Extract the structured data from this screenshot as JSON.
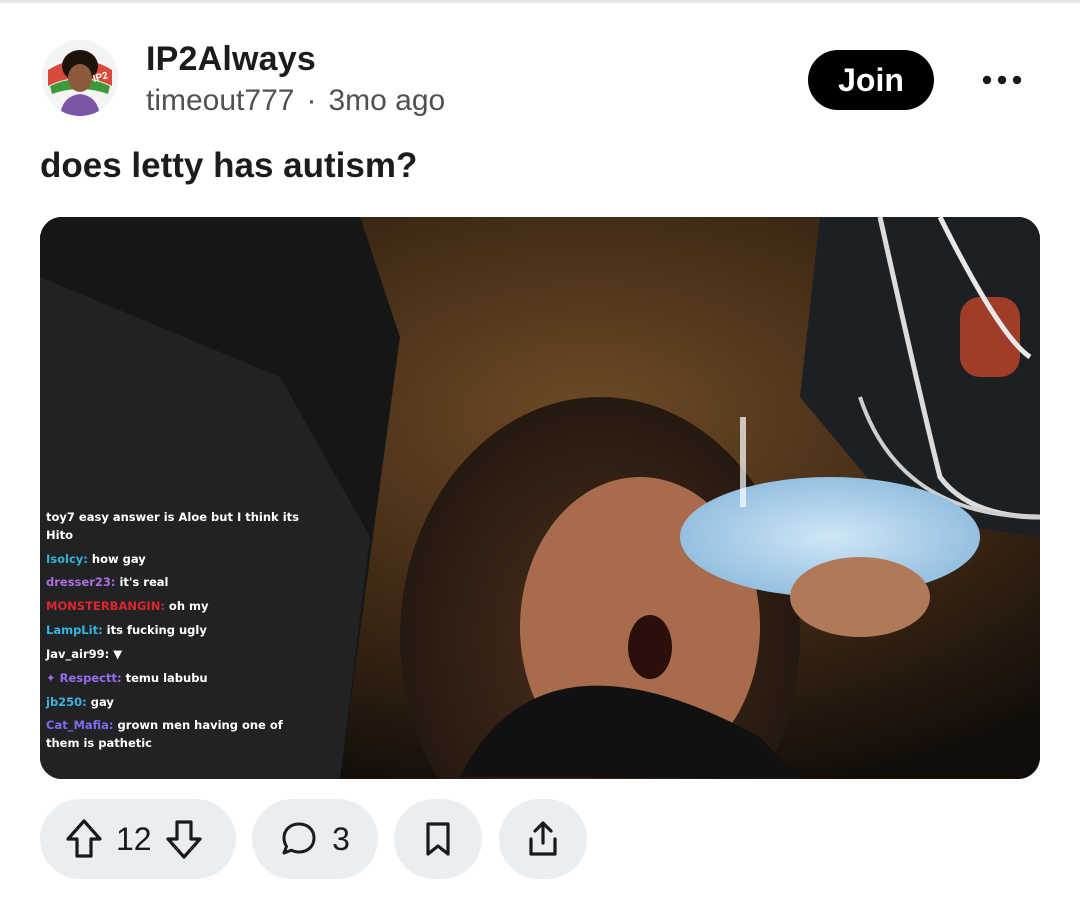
{
  "community": {
    "name": "IP2Always",
    "author": "timeout777",
    "separator": "·",
    "age": "3mo ago",
    "avatar_text": "IP2"
  },
  "join_label": "Join",
  "post": {
    "title": "does letty has autism?"
  },
  "video_chat": [
    {
      "user": "toy7",
      "text": " easy answer is Aloe but I think its Hito",
      "color": "#ffffff"
    },
    {
      "user": "Isolcy:",
      "text": " how gay",
      "color": "#2fb4d6"
    },
    {
      "user": "dresser23:",
      "text": " it's real",
      "color": "#b06ce0"
    },
    {
      "user": "MONSTERBANGIN:",
      "text": " oh my",
      "color": "#e0262d"
    },
    {
      "user": "LampLit:",
      "text": " its fucking ugly",
      "color": "#35b6e0"
    },
    {
      "user": "Jav_air99:",
      "text": " ▼",
      "color": "#ffffff"
    },
    {
      "user": "✦ Respectt:",
      "text": " temu labubu",
      "color": "#9b6cf2"
    },
    {
      "user": "jb250:",
      "text": " gay",
      "color": "#3fb5de"
    },
    {
      "user": "Cat_Mafia:",
      "text": " grown men having one of them is pathetic",
      "color": "#7a6cf0"
    }
  ],
  "actions": {
    "upvotes": "12",
    "comments": "3"
  },
  "icons": {
    "more": "more-horizontal-icon",
    "upvote": "arrow-up-icon",
    "downvote": "arrow-down-icon",
    "comment": "comment-bubble-icon",
    "save": "bookmark-icon",
    "share": "share-icon"
  },
  "colors": {
    "join_bg": "#000000",
    "pill_bg": "#eaeef1",
    "meta_text": "#4f5154"
  }
}
